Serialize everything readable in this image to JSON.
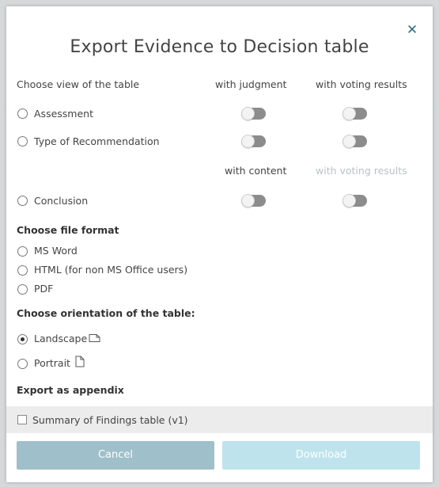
{
  "dialog": {
    "title": "Export Evidence to Decision table",
    "close_icon": "close-icon"
  },
  "view_section": {
    "heading": "Choose view of the table",
    "col_judgment": "with judgment",
    "col_voting": "with voting results",
    "col_content": "with content",
    "col_voting_disabled": "with voting results",
    "options": [
      {
        "label": "Assessment",
        "selected": false,
        "toggle1_on": false,
        "toggle2_on": false
      },
      {
        "label": "Type of Recommendation",
        "selected": false,
        "toggle1_on": false,
        "toggle2_on": false
      },
      {
        "label": "Conclusion",
        "selected": false,
        "toggle1_on": false,
        "toggle2_on": false
      }
    ]
  },
  "format_section": {
    "heading": "Choose file format",
    "options": [
      {
        "label": "MS Word",
        "selected": false
      },
      {
        "label": "HTML (for non MS Office users)",
        "selected": false
      },
      {
        "label": "PDF",
        "selected": false
      }
    ]
  },
  "orientation_section": {
    "heading": "Choose orientation of the table:",
    "options": [
      {
        "label": "Landscape",
        "selected": true,
        "icon": "landscape-page-icon"
      },
      {
        "label": "Portrait",
        "selected": false,
        "icon": "portrait-page-icon"
      }
    ]
  },
  "appendix_section": {
    "heading": "Export as appendix",
    "item_label": "Summary of Findings table (v1)",
    "checked": false
  },
  "buttons": {
    "cancel": "Cancel",
    "download": "Download"
  },
  "colors": {
    "accent": "#2f6f87",
    "cancel_bg": "#9fbfca",
    "download_bg": "#bfe3ec",
    "toggle_off": "#8c8c8c"
  }
}
